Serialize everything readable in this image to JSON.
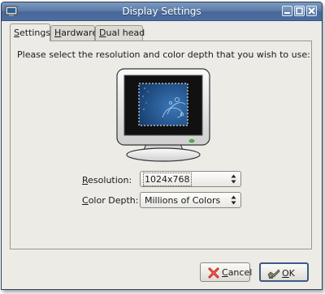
{
  "window": {
    "title": "Display Settings"
  },
  "tabs": [
    {
      "label": "Settings",
      "mnemonic": "S",
      "rest": "ettings",
      "active": true
    },
    {
      "label": "Hardware",
      "mnemonic": "H",
      "rest": "ardware",
      "active": false
    },
    {
      "label": "Dual head",
      "mnemonic": "D",
      "rest": "ual head",
      "active": false
    }
  ],
  "settings": {
    "instruction": "Please select the resolution and color depth that you wish to use:",
    "resolution": {
      "label_mnemonic": "R",
      "label_rest": "esolution:",
      "value": "1024x768"
    },
    "color_depth": {
      "label_mnemonic": "C",
      "label_rest": "olor Depth:",
      "value": "Millions of Colors"
    }
  },
  "buttons": {
    "cancel": {
      "mnemonic": "C",
      "rest": "ancel"
    },
    "ok": {
      "mnemonic": "O",
      "rest": "K"
    }
  },
  "colors": {
    "titlebar": "#5a7ba6",
    "window_bg": "#ecebe6",
    "screen_bg": "#1f4f86"
  }
}
